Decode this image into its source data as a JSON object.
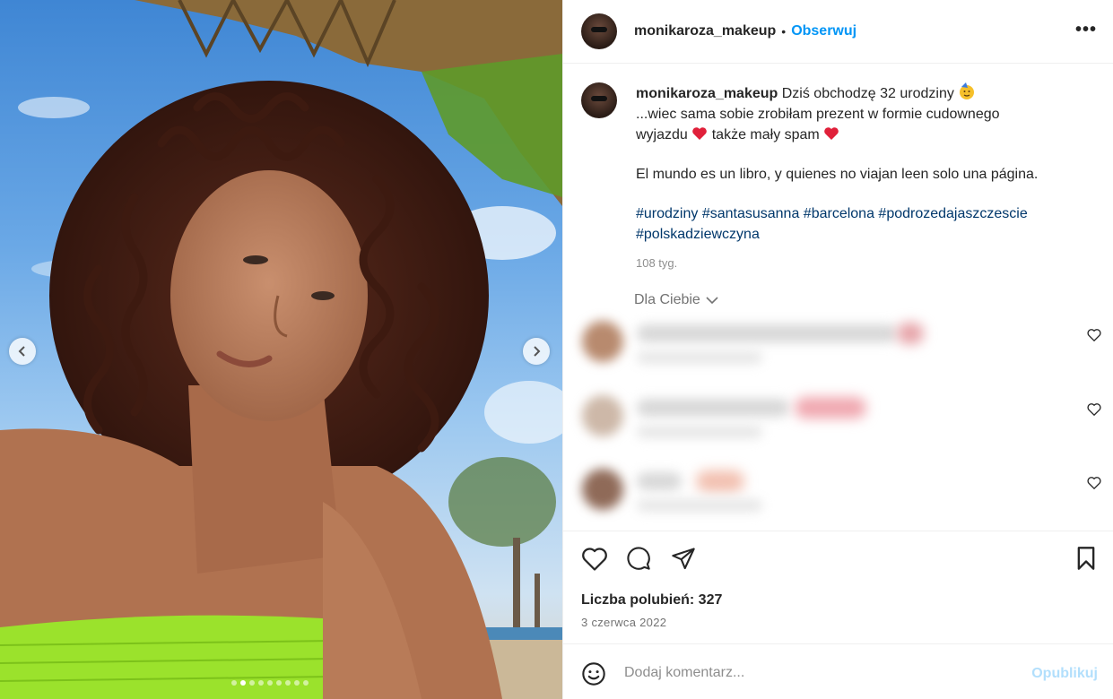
{
  "post": {
    "username": "monikaroza_makeup",
    "separator": "•",
    "follow_label": "Obserwuj",
    "more_label": "•••",
    "caption": {
      "username": "monikaroza_makeup",
      "line1": "Dziś obchodzę 32 urodziny",
      "line2": "...wiec sama sobie zrobiłam prezent w formie cudownego",
      "line3a": "wyjazdu",
      "line3b": "także mały spam",
      "quote": "El mundo es un libro, y quienes no viajan leen solo una página.",
      "hashtags_line1": "#urodziny #santasusanna #barcelona #podrozedajaszczescie",
      "hashtags_line2": "#polskadziewczyna",
      "time_ago": "108 tyg."
    },
    "for_you_label": "Dla Ciebie",
    "likes_label": "Liczba polubień: 327",
    "date": "3 czerwca 2022",
    "comment_placeholder": "Dodaj komentarz...",
    "publish_label": "Opublikuj",
    "carousel": {
      "dot_count": 9,
      "active_index": 1
    }
  },
  "icons": {
    "like": "heart-outline-icon",
    "comment": "speech-bubble-icon",
    "share": "paper-plane-icon",
    "save": "bookmark-icon",
    "emoji": "smiley-icon"
  },
  "colors": {
    "accent": "#0095f6",
    "hashtag": "#00376b",
    "muted": "#8e8e8e",
    "publish_disabled": "#b2dffc",
    "heart_emoji": "#e0203a",
    "swimsuit": "#9be22c"
  }
}
